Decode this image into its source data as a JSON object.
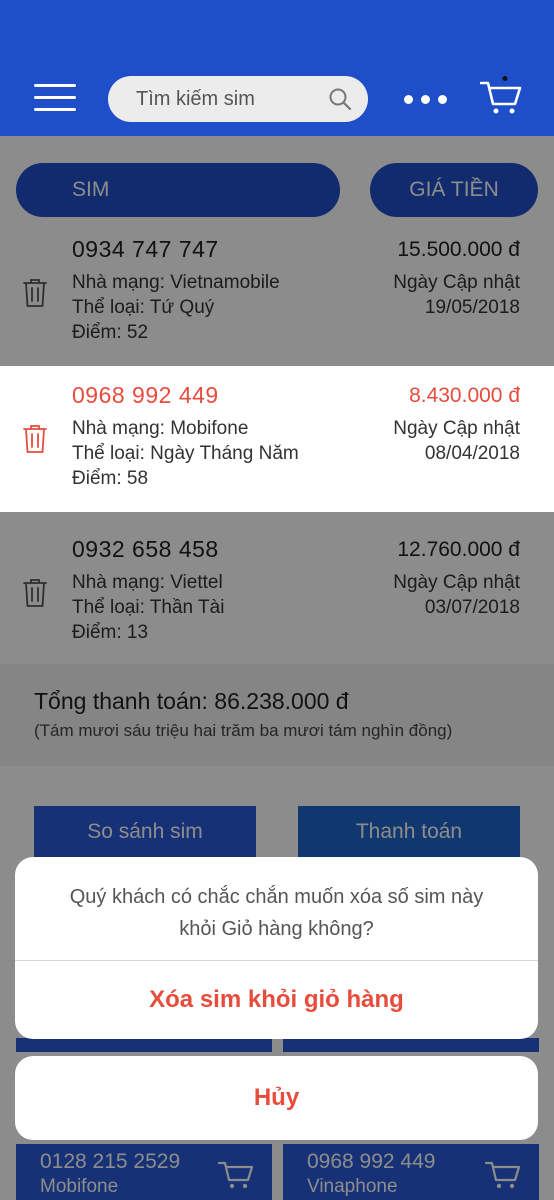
{
  "header": {
    "search_placeholder": "Tìm kiếm sim"
  },
  "tabs": {
    "sim_label": "SIM",
    "price_label": "GIÁ TIỀN"
  },
  "cart_items": [
    {
      "number": "0934 747 747",
      "carrier": "Nhà mạng: Vietnamobile",
      "category": "Thể loại: Tứ Quý",
      "score": "Điểm: 52",
      "price": "15.500.000 đ",
      "updated_label": "Ngày Cập nhật",
      "updated_date": "19/05/2018"
    },
    {
      "number": "0968 992 449",
      "carrier": "Nhà mạng: Mobifone",
      "category": "Thể loại: Ngày Tháng Năm",
      "score": "Điểm: 58",
      "price": "8.430.000 đ",
      "updated_label": "Ngày Cập nhật",
      "updated_date": "08/04/2018"
    },
    {
      "number": "0932 658 458",
      "carrier": "Nhà mạng: Viettel",
      "category": "Thể loại: Thần Tài",
      "score": "Điểm: 13",
      "price": "12.760.000 đ",
      "updated_label": "Ngày Cập nhật",
      "updated_date": "03/07/2018"
    }
  ],
  "total": {
    "label": "Tổng thanh toán: 86.238.000 đ",
    "in_words": "(Tám mươi sáu triệu hai trăm ba mươi tám nghìn đồng)"
  },
  "actions": {
    "compare_label": "So sánh sim",
    "pay_label": "Thanh toán"
  },
  "suggestions": [
    {
      "number": "0128 215 2529",
      "carrier": "Mobifone"
    },
    {
      "number": "0968 992 449",
      "carrier": "Vinaphone"
    }
  ],
  "dialog": {
    "message_line1": "Quý khách có chắc chắn muốn xóa số sim này",
    "message_line2": "khỏi Giỏ hàng không?",
    "confirm_label": "Xóa sim khỏi giỏ hàng",
    "cancel_label": "Hủy"
  },
  "colors": {
    "brand_blue": "#1f4fc8",
    "destructive_red": "#e74c3c"
  }
}
